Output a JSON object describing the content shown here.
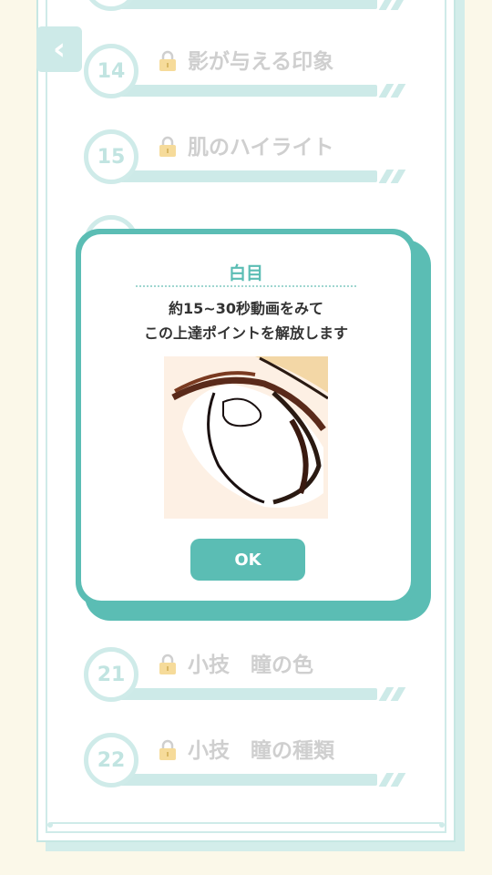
{
  "back_icon": "chevron-left-icon",
  "lock_icon": "lock-icon",
  "lessons": [
    {
      "number": "14",
      "title": "影が与える印象"
    },
    {
      "number": "15",
      "title": "肌のハイライト"
    },
    {
      "number": "21",
      "title": "小技　瞳の色"
    },
    {
      "number": "22",
      "title": "小技　瞳の種類"
    }
  ],
  "dialog": {
    "title": "白目",
    "message_line1": "約15~30秒動画をみて",
    "message_line2": "この上達ポイントを解放します",
    "ok_label": "OK"
  },
  "colors": {
    "accent": "#5bbdb4",
    "light_accent": "#c9e9e6",
    "background": "#fbf8e6"
  }
}
